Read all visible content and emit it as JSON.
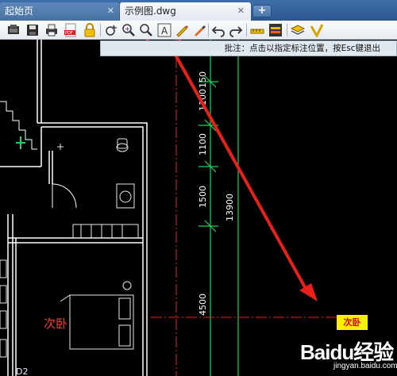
{
  "tabs": {
    "home_label": "起始页",
    "active_label": "示例图.dwg",
    "close_glyph": "✕",
    "add_glyph": "+"
  },
  "toolbar": {
    "icons": [
      "open-icon",
      "save-icon",
      "print-icon",
      "pdf-icon",
      "lock-icon",
      "cloud-icon",
      "zoom-window-icon",
      "zoom-in-icon",
      "zoom-out-icon",
      "text-annotation-icon",
      "pencil-icon",
      "highlighter-icon",
      "undo-icon",
      "redo-icon",
      "measure-icon",
      "layer-color-icon",
      "layers-icon",
      "check-icon"
    ],
    "highlight_color": "#e8201a"
  },
  "hint": {
    "text": "批注：点击以指定标注位置，按Esc键退出"
  },
  "drawing": {
    "dimensions": [
      "1100",
      "1100",
      "1500",
      "13900",
      "4500",
      "150"
    ],
    "room_label": "次卧",
    "annotation_tag": "次卧",
    "corner_label": "D2"
  },
  "watermark": {
    "brand": "Baidu经验",
    "url": "jingyan.baidu.com"
  },
  "colors": {
    "background": "#000000",
    "wall": "#ffffff",
    "green_lines": "#19d35a",
    "red_lines": "#e82020",
    "tag": "#ffee00"
  }
}
